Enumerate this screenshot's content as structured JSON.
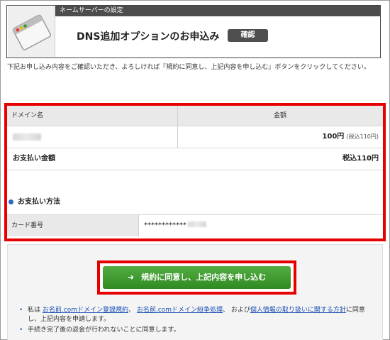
{
  "header": {
    "bar_label": "ネームサーバーの設定",
    "title": "DNS追加オプションのお申込み",
    "badge": "確認"
  },
  "description": "下記お申し込み内容をご確認いただき、よろしければ『規約に同意し、上記内容を申し込む』ボタンをクリックしてください。",
  "table": {
    "col_domain": "ドメイン名",
    "col_amount": "金額",
    "price": "100円",
    "price_tax": "(税込110円)",
    "total_label": "お支払い金額",
    "total_value": "税込110円"
  },
  "payment": {
    "heading": "お支払い方法",
    "card_label": "カード番号",
    "card_value": "************"
  },
  "submit_button": "規約に同意し、上記内容を申し込む",
  "notes": {
    "n1_pre": "私は",
    "n1_link1": "お名前.comドメイン登録規約",
    "n1_sep": "、",
    "n1_link2": "お名前.comドメイン紛争処理",
    "n1_mid": "、 および",
    "n1_link3": "個人情報の取り扱いに関する方針",
    "n1_post": "に同意し、上記内容を申請します。",
    "n2": "手続き完了後の返金が行われないことに同意します。"
  },
  "colors": {
    "highlight": "#e60000",
    "button": "#3d9a2e",
    "accent_dot": "#2a68c8"
  }
}
